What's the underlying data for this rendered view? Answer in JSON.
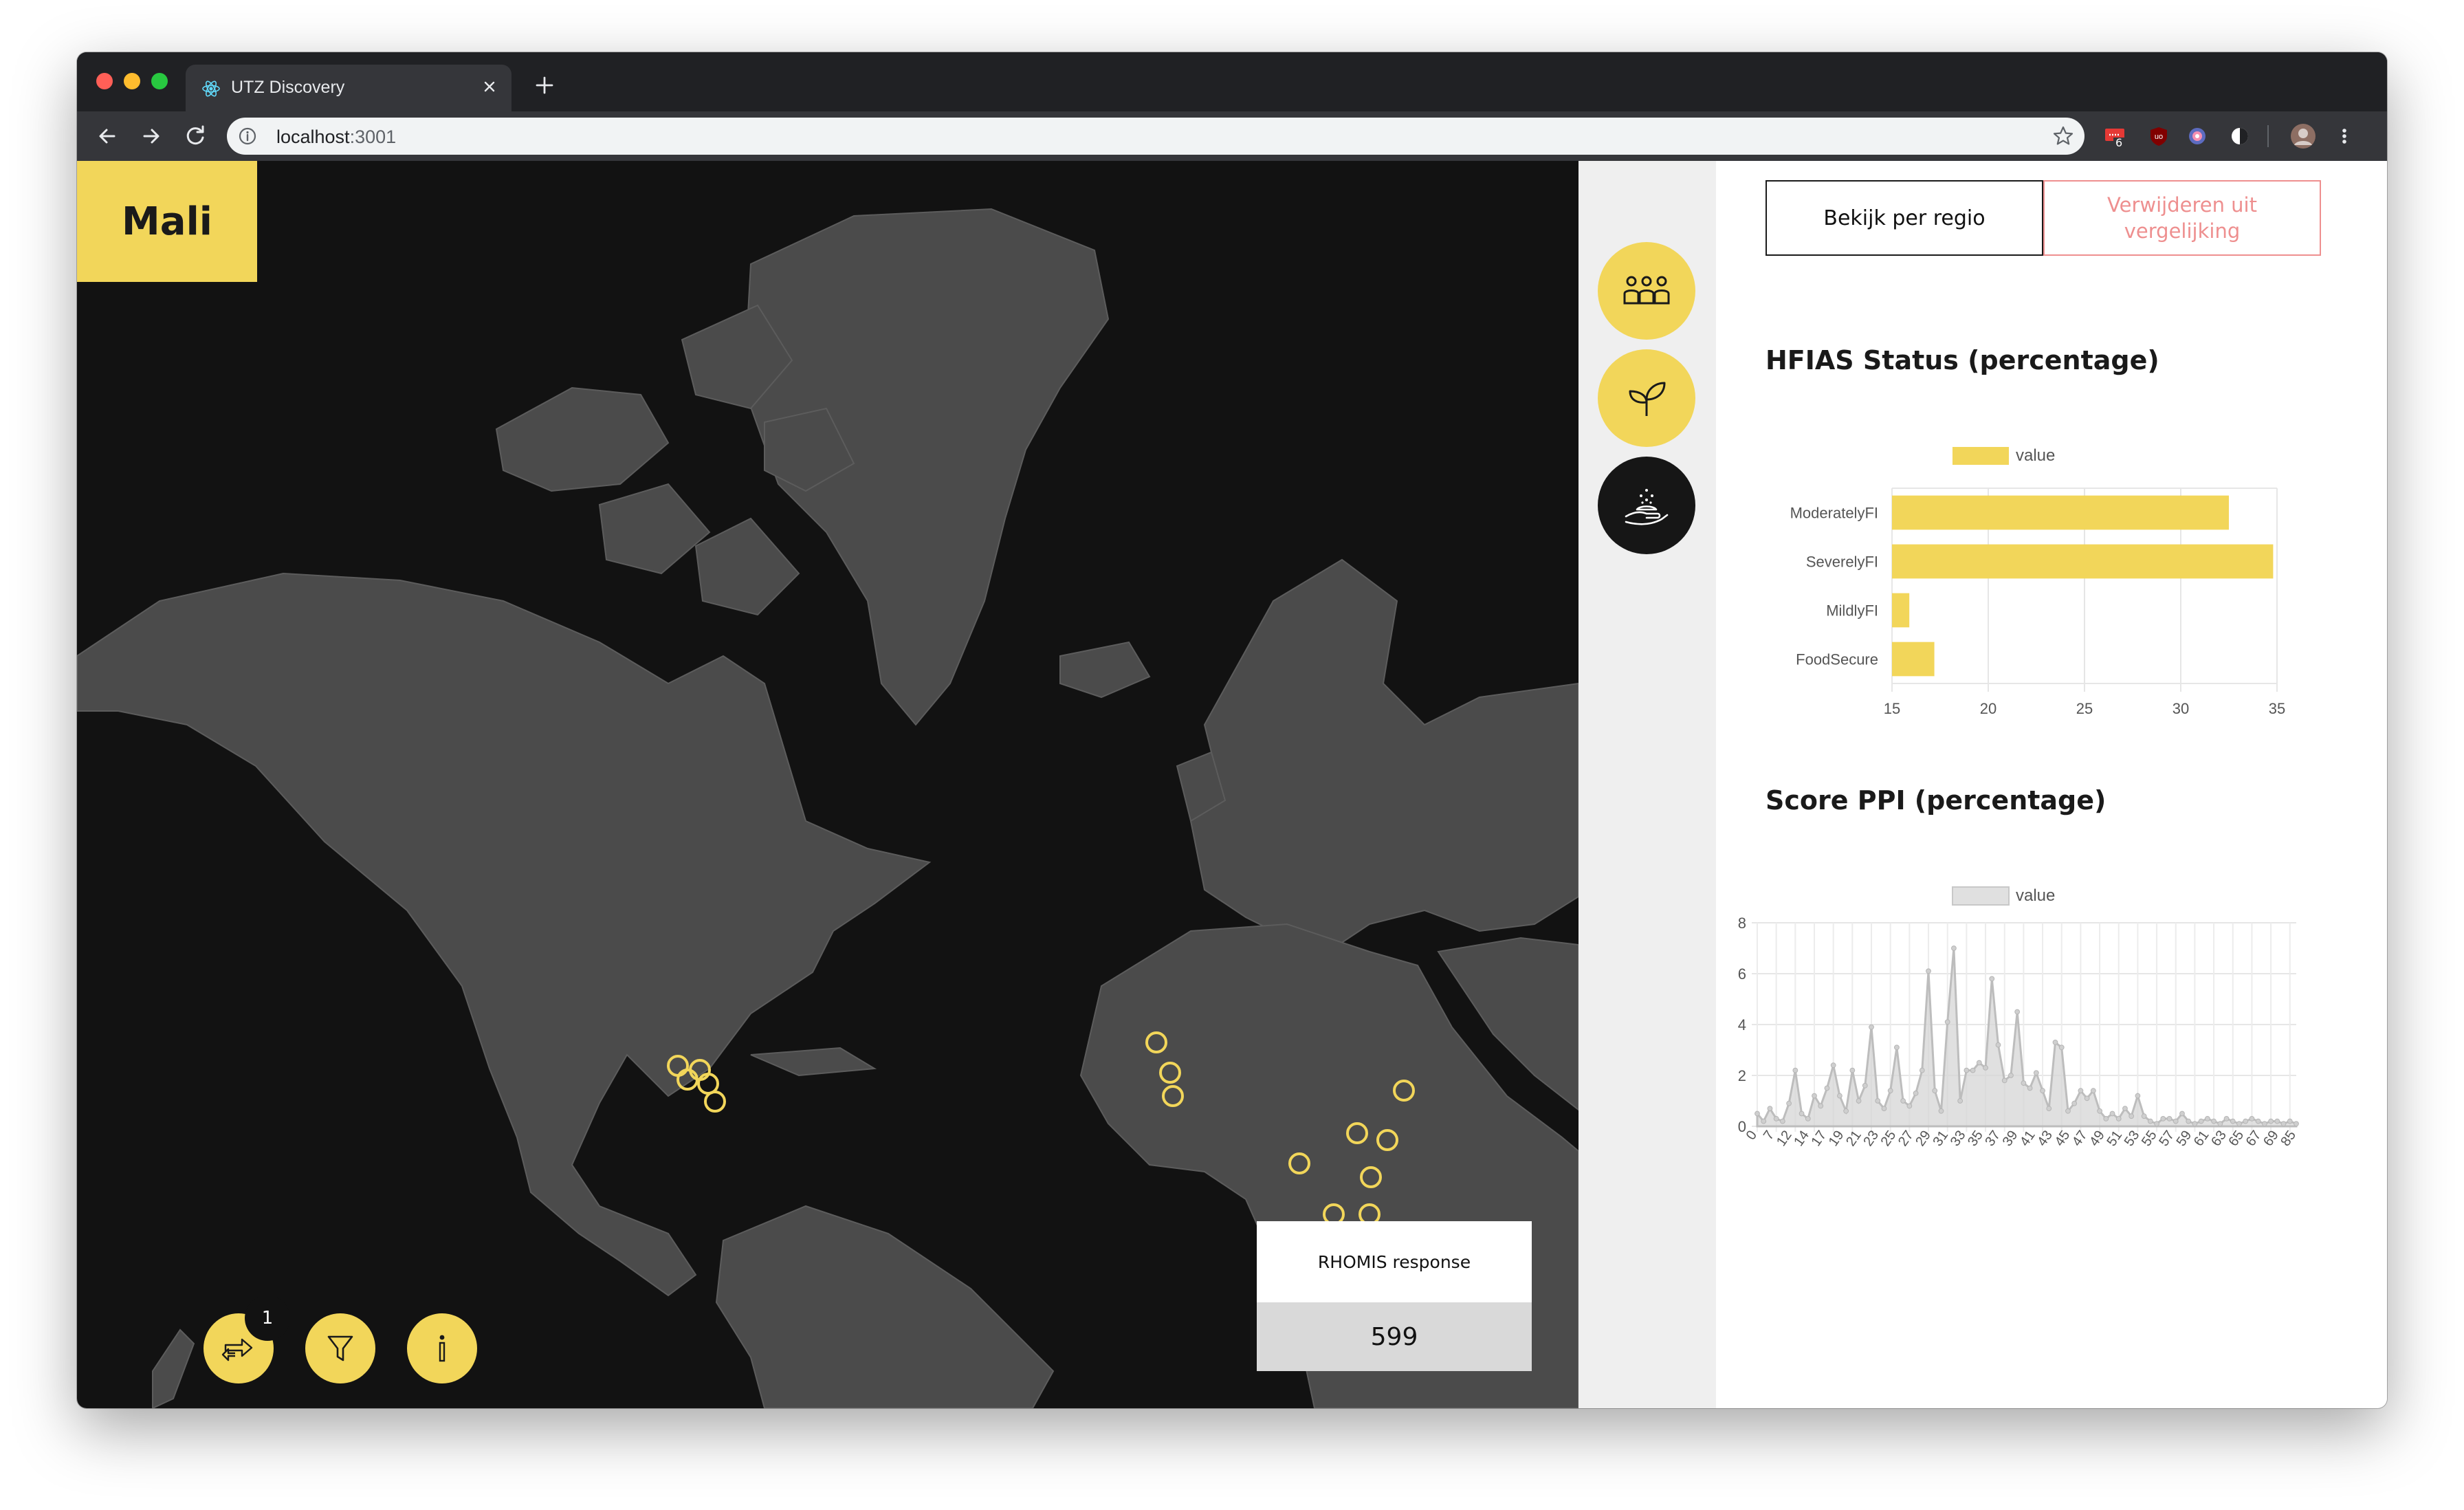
{
  "browser": {
    "tab_title": "UTZ Discovery",
    "url_host": "localhost",
    "url_port": ":3001",
    "ext_badge": "6"
  },
  "map": {
    "country": "Mali",
    "compare_count": "1",
    "rhomis_label": "RHOMIS response",
    "rhomis_value": "599",
    "colors": {
      "ocean": "#121212",
      "land": "#4b4b4b",
      "marker": "#f2d65a",
      "accent": "#f2d65a"
    }
  },
  "rail": {
    "icons": [
      "people-icon",
      "sprout-icon",
      "hand-seed-icon"
    ],
    "active": "hand-seed-icon"
  },
  "panel": {
    "region_button": "Bekijk per regio",
    "remove_button": "Verwijderen uit vergelijking",
    "hfias_title": "HFIAS Status (percentage)",
    "ppi_title": "Score PPI (percentage)"
  },
  "chart_data": [
    {
      "type": "bar",
      "orientation": "horizontal",
      "title": "HFIAS Status (percentage)",
      "legend": "value",
      "categories": [
        "ModeratelyFI",
        "SeverelyFI",
        "MildlyFI",
        "FoodSecure"
      ],
      "values": [
        32.5,
        34.8,
        15.9,
        17.2
      ],
      "xlim": [
        15,
        35
      ],
      "xticks": [
        "15",
        "20",
        "25",
        "30",
        "35"
      ],
      "color": "#f2d65a",
      "grid": true,
      "legend_position": "top"
    },
    {
      "type": "area",
      "title": "Score PPI (percentage)",
      "legend": "value",
      "x": [
        0,
        1,
        2,
        3,
        4,
        5,
        6,
        7,
        8,
        9,
        10,
        11,
        12,
        13,
        14,
        15,
        16,
        17,
        18,
        19,
        20,
        21,
        22,
        23,
        24,
        25,
        26,
        27,
        28,
        29,
        30,
        31,
        32,
        33,
        34,
        35,
        36,
        37,
        38,
        39,
        40,
        41,
        42,
        43,
        44,
        45,
        46,
        47,
        48,
        49,
        50,
        51,
        52,
        53,
        54,
        55,
        56,
        57,
        58,
        59,
        60,
        61,
        62,
        63,
        64,
        65,
        66,
        67,
        68,
        69,
        70,
        71,
        72,
        73,
        74,
        75,
        76,
        77,
        78,
        79,
        80,
        81,
        82,
        83,
        84,
        85
      ],
      "values": [
        0.5,
        0.2,
        0.7,
        0.3,
        0.2,
        0.9,
        2.2,
        0.5,
        0.3,
        1.2,
        0.8,
        1.5,
        2.4,
        1.2,
        0.6,
        2.2,
        1.0,
        1.6,
        3.9,
        1.0,
        0.7,
        1.4,
        3.1,
        1.0,
        0.8,
        1.3,
        2.2,
        6.1,
        1.4,
        0.6,
        4.1,
        7.0,
        1.0,
        2.2,
        2.2,
        2.5,
        2.3,
        5.8,
        3.2,
        1.8,
        2.0,
        4.5,
        1.7,
        1.5,
        2.1,
        1.4,
        0.7,
        3.3,
        3.1,
        0.6,
        0.9,
        1.4,
        1.1,
        1.4,
        0.6,
        0.3,
        0.5,
        0.3,
        0.7,
        0.4,
        1.2,
        0.4,
        0.2,
        0.1,
        0.3,
        0.3,
        0.2,
        0.5,
        0.2,
        0.1,
        0.2,
        0.3,
        0.2,
        0.1,
        0.3,
        0.2,
        0.1,
        0.2,
        0.3,
        0.2,
        0.1,
        0.2,
        0.2,
        0.1,
        0.2,
        0.1
      ],
      "xtick_labels": [
        "0",
        "7",
        "12",
        "14",
        "17",
        "19",
        "21",
        "23",
        "25",
        "27",
        "29",
        "31",
        "33",
        "35",
        "37",
        "39",
        "41",
        "43",
        "45",
        "47",
        "49",
        "51",
        "53",
        "55",
        "57",
        "59",
        "61",
        "63",
        "65",
        "67",
        "69",
        "85"
      ],
      "ylim": [
        0,
        8
      ],
      "yticks": [
        "0",
        "2",
        "4",
        "6",
        "8"
      ],
      "color": "#bdbdbd",
      "grid": true,
      "legend_position": "top"
    }
  ]
}
